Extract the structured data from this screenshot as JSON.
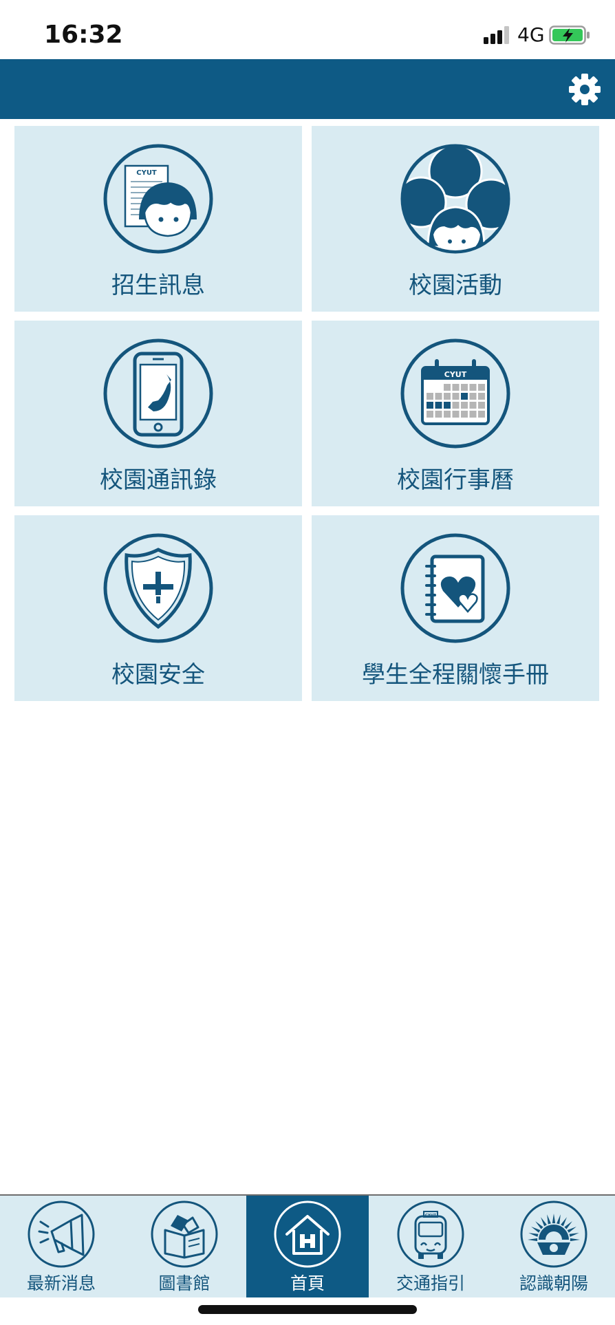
{
  "status_bar": {
    "time": "16:32",
    "network": "4G"
  },
  "tiles": [
    {
      "label": "招生訊息"
    },
    {
      "label": "校園活動"
    },
    {
      "label": "校園通訊錄"
    },
    {
      "label": "校園行事曆"
    },
    {
      "label": "校園安全"
    },
    {
      "label": "學生全程關懷手冊"
    }
  ],
  "icon_text": {
    "brand": "CYUT"
  },
  "bottom_nav": {
    "active_index": 2,
    "items": [
      {
        "label": "最新消息"
      },
      {
        "label": "圖書館"
      },
      {
        "label": "首頁"
      },
      {
        "label": "交通指引"
      },
      {
        "label": "認識朝陽"
      }
    ]
  },
  "colors": {
    "primary": "#0e5a85",
    "tile_background": "#d9ebf2",
    "label_text": "#14557c",
    "battery_fill": "#34c759"
  }
}
